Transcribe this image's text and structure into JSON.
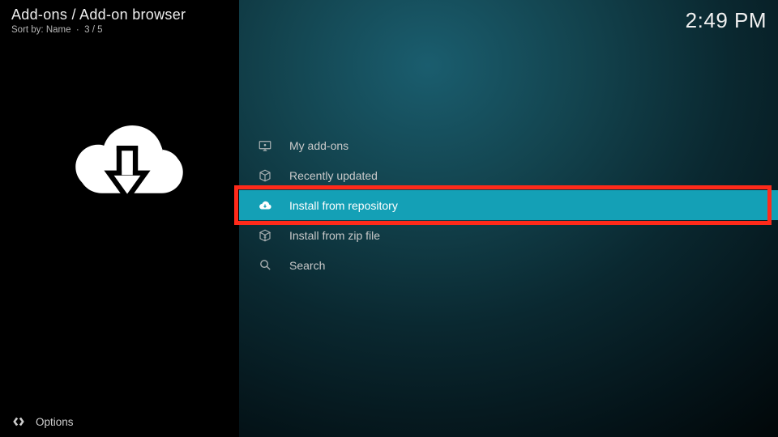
{
  "breadcrumb": "Add-ons / Add-on browser",
  "sort": {
    "prefix": "Sort by:",
    "field": "Name",
    "position": "3 / 5"
  },
  "clock": "2:49 PM",
  "options_label": "Options",
  "menu": {
    "items": [
      {
        "label": "My add-ons",
        "icon": "monitor-icon",
        "selected": false
      },
      {
        "label": "Recently updated",
        "icon": "box-icon",
        "selected": false
      },
      {
        "label": "Install from repository",
        "icon": "download-cloud-icon",
        "selected": true
      },
      {
        "label": "Install from zip file",
        "icon": "zip-icon",
        "selected": false
      },
      {
        "label": "Search",
        "icon": "search-icon",
        "selected": false
      }
    ]
  },
  "colors": {
    "accent": "#14a0b6",
    "highlight_border": "#ff2a1a"
  }
}
